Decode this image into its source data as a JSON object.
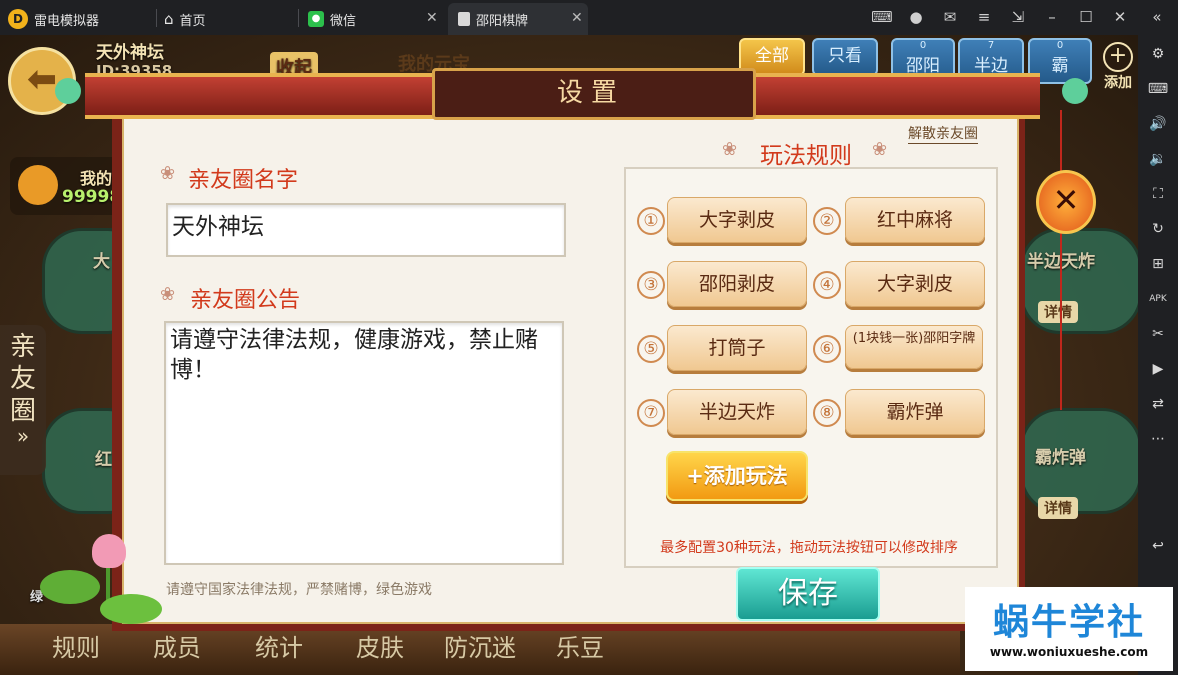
{
  "titlebar": {
    "app_name": "雷电模拟器",
    "tabs": [
      {
        "label": "首页",
        "icon": "home-icon"
      },
      {
        "label": "微信",
        "icon": "wechat-icon"
      },
      {
        "label": "邵阳棋牌",
        "icon": "game-icon"
      }
    ],
    "close_glyph": "✕"
  },
  "game_bg": {
    "player_name": "天外神坛",
    "player_id": "ID:39358",
    "collapse_label": "收起",
    "my_yuanbao": "我的元宝",
    "my_label": "我的",
    "my_amount": "99998",
    "tab_all": "全部",
    "tab_only": "只看",
    "top_tabs": [
      {
        "count": "0",
        "label": "邵阳"
      },
      {
        "count": "7",
        "label": "半边"
      },
      {
        "count": "0",
        "label": "霸"
      }
    ],
    "add_label": "添加",
    "side_circle": "亲友圈",
    "side_chevron": "»",
    "table_texts": [
      "大",
      "红中",
      "半边天炸",
      "霸炸弹",
      "详情",
      "详情"
    ],
    "bottom_nav": [
      "规则",
      "成员",
      "统计",
      "皮肤",
      "防沉迷",
      "乐豆"
    ],
    "left_small": "绿"
  },
  "dialog": {
    "title": "设置",
    "disband": "解散亲友圈",
    "name_label": "亲友圈名字",
    "name_value": "天外神坛",
    "notice_label": "亲友圈公告",
    "notice_value": "请遵守法律法规，健康游戏，禁止赌博！",
    "footer_note": "请遵守国家法律法规，严禁赌博，绿色游戏",
    "rules_title": "玩法规则",
    "rules": [
      {
        "num": "①",
        "label": "大字剥皮"
      },
      {
        "num": "②",
        "label": "红中麻将"
      },
      {
        "num": "③",
        "label": "邵阳剥皮"
      },
      {
        "num": "④",
        "label": "大字剥皮"
      },
      {
        "num": "⑤",
        "label": "打筒子"
      },
      {
        "num": "⑥",
        "label": "(1块钱一张)邵阳字牌"
      },
      {
        "num": "⑦",
        "label": "半边天炸"
      },
      {
        "num": "⑧",
        "label": "霸炸弹"
      }
    ],
    "add_rule": "+添加玩法",
    "rules_note": "最多配置30种玩法，拖动玩法按钮可以修改排序",
    "save": "保存",
    "close": "✕"
  },
  "watermark": {
    "title": "蜗牛学社",
    "url": "www.woniuxueshe.com"
  },
  "colors": {
    "accent_red": "#d23a1c",
    "title_bar": "#1f2023",
    "save_teal": "#1a9d91"
  }
}
